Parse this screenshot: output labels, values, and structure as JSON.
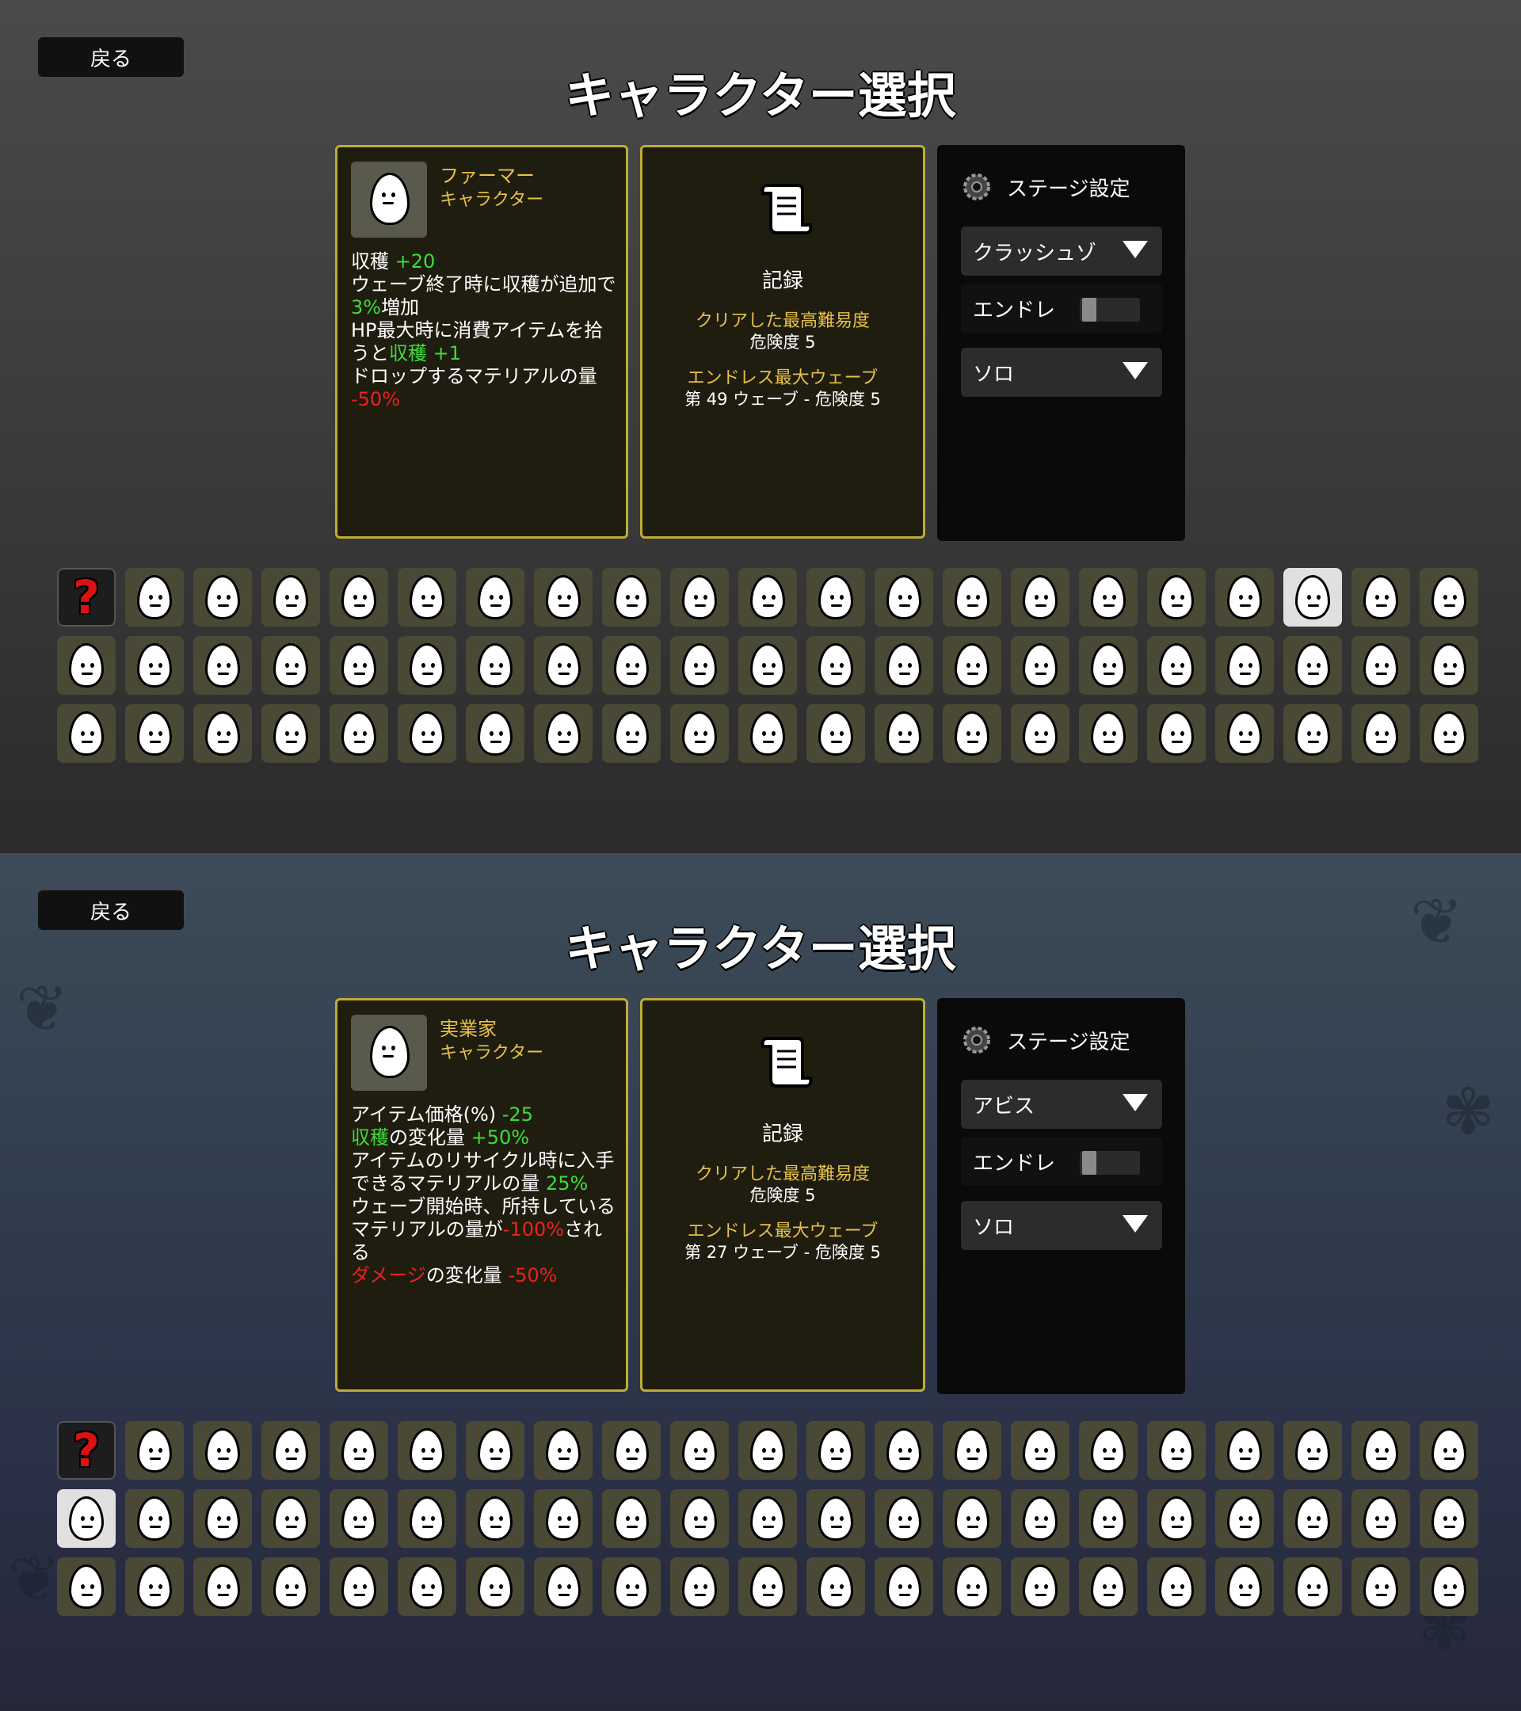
{
  "screens": [
    {
      "back_label": "戻る",
      "title": "キャラクター選択",
      "character": {
        "name": "ファーマー",
        "type": "キャラクター",
        "stats": [
          [
            {
              "t": "収穫 ",
              "c": ""
            },
            {
              "t": "+20",
              "c": "g"
            }
          ],
          [
            {
              "t": "ウェーブ終了時に収穫が追加で",
              "c": ""
            },
            {
              "t": "3%",
              "c": "g"
            },
            {
              "t": "増加",
              "c": ""
            }
          ],
          [
            {
              "t": "HP最大時に消費アイテムを拾うと",
              "c": ""
            },
            {
              "t": "収穫 +1",
              "c": "g"
            }
          ],
          [
            {
              "t": "ドロップするマテリアルの量 ",
              "c": ""
            },
            {
              "t": "-50%",
              "c": "r"
            }
          ]
        ]
      },
      "record": {
        "heading": "記録",
        "best_difficulty_label": "クリアした最高難易度",
        "best_difficulty_value": "危険度 5",
        "endless_label": "エンドレス最大ウェーブ",
        "endless_value": "第 49 ウェーブ - 危険度 5"
      },
      "stage": {
        "heading": "ステージ設定",
        "zone": "クラッシュゾ",
        "endless_label": "エンドレ",
        "endless_on": false,
        "mode": "ソロ"
      },
      "selected_index": 18
    },
    {
      "back_label": "戻る",
      "title": "キャラクター選択",
      "character": {
        "name": "実業家",
        "type": "キャラクター",
        "stats": [
          [
            {
              "t": "アイテム価格(%) ",
              "c": ""
            },
            {
              "t": "-25",
              "c": "g"
            }
          ],
          [
            {
              "t": "収穫",
              "c": "g"
            },
            {
              "t": "の変化量 ",
              "c": ""
            },
            {
              "t": "+50%",
              "c": "g"
            }
          ],
          [
            {
              "t": "アイテムのリサイクル時に入手できるマテリアルの量 ",
              "c": ""
            },
            {
              "t": "25%",
              "c": "g"
            }
          ],
          [
            {
              "t": "ウェーブ開始時、所持しているマテリアルの量が",
              "c": ""
            },
            {
              "t": "-100%",
              "c": "r"
            },
            {
              "t": "される",
              "c": ""
            }
          ],
          [
            {
              "t": "ダメージ",
              "c": "r"
            },
            {
              "t": "の変化量 ",
              "c": ""
            },
            {
              "t": "-50%",
              "c": "r"
            }
          ]
        ]
      },
      "record": {
        "heading": "記録",
        "best_difficulty_label": "クリアした最高難易度",
        "best_difficulty_value": "危険度 5",
        "endless_label": "エンドレス最大ウェーブ",
        "endless_value": "第 27 ウェーブ - 危険度 5"
      },
      "stage": {
        "heading": "ステージ設定",
        "zone": "アビス",
        "endless_label": "エンドレ",
        "endless_on": false,
        "mode": "ソロ"
      },
      "selected_index": 21
    }
  ],
  "grid": {
    "rows": 3,
    "cols": 21,
    "random_icon": "question-mark-icon"
  }
}
